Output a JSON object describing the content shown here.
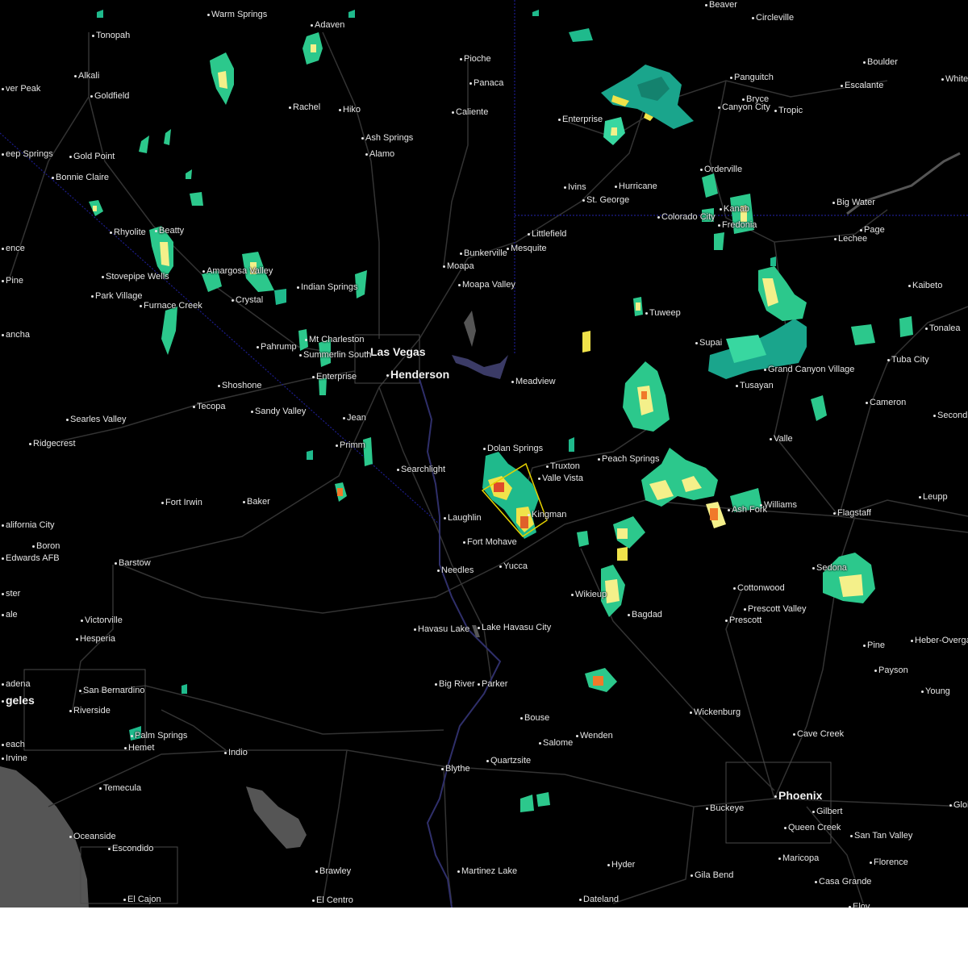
{
  "map": {
    "background_color": "#000000",
    "ocean_color": "#555555",
    "road_color": "#3a3a3a",
    "state_border_color": "#1c1c8c",
    "river_color": "#3b3b66",
    "warning_polygon_color": "#e6d200"
  },
  "cities": [
    {
      "name": "Warm Springs"
    },
    {
      "name": "Beaver"
    },
    {
      "name": "Circleville"
    },
    {
      "name": "Tonopah"
    },
    {
      "name": "Adaven"
    },
    {
      "name": "Pioche"
    },
    {
      "name": "Boulder"
    },
    {
      "name": "White C"
    },
    {
      "name": "ver Peak"
    },
    {
      "name": "Alkali"
    },
    {
      "name": "Panaca"
    },
    {
      "name": "Panguitch"
    },
    {
      "name": "Escalante"
    },
    {
      "name": "Goldfield"
    },
    {
      "name": "Rachel"
    },
    {
      "name": "Hiko"
    },
    {
      "name": "Caliente"
    },
    {
      "name": "Bryce"
    },
    {
      "name": "Canyon City"
    },
    {
      "name": "Tropic"
    },
    {
      "name": "Enterprise"
    },
    {
      "name": "Ash Springs"
    },
    {
      "name": "eep Springs"
    },
    {
      "name": "Alamo"
    },
    {
      "name": "Gold Point"
    },
    {
      "name": "Orderville"
    },
    {
      "name": "Bonnie Claire"
    },
    {
      "name": "Ivins"
    },
    {
      "name": "Hurricane"
    },
    {
      "name": "St. George"
    },
    {
      "name": "Big Water"
    },
    {
      "name": "Kanab"
    },
    {
      "name": "Colorado City"
    },
    {
      "name": "Fredonia"
    },
    {
      "name": "Page"
    },
    {
      "name": "Rhyolite"
    },
    {
      "name": "Beatty"
    },
    {
      "name": "Littlefield"
    },
    {
      "name": "Lechee"
    },
    {
      "name": "Bunkerville"
    },
    {
      "name": "Mesquite"
    },
    {
      "name": "ence"
    },
    {
      "name": "Amargosa Valley"
    },
    {
      "name": "Moapa"
    },
    {
      "name": "Pine"
    },
    {
      "name": "Stovepipe Wells"
    },
    {
      "name": "Indian Springs"
    },
    {
      "name": "Moapa Valley"
    },
    {
      "name": "Kaibeto"
    },
    {
      "name": "Park Village"
    },
    {
      "name": "Crystal"
    },
    {
      "name": "Furnace Creek"
    },
    {
      "name": "Tuweep"
    },
    {
      "name": "Tonalea"
    },
    {
      "name": "ancha"
    },
    {
      "name": "Mt Charleston"
    },
    {
      "name": "Supai"
    },
    {
      "name": "Tusayan"
    },
    {
      "name": "Grand Canyon Village"
    },
    {
      "name": "Tuba City"
    },
    {
      "name": "Pahrump"
    },
    {
      "name": "Las Vegas",
      "major": true
    },
    {
      "name": "Summerlin South"
    },
    {
      "name": "Henderson",
      "major": true
    },
    {
      "name": "Enterprise"
    },
    {
      "name": "Meadview"
    },
    {
      "name": "Shoshone"
    },
    {
      "name": "Tecopa"
    },
    {
      "name": "Sandy Valley"
    },
    {
      "name": "Cameron"
    },
    {
      "name": "Second M"
    },
    {
      "name": "Searles Valley"
    },
    {
      "name": "Jean"
    },
    {
      "name": "Valle"
    },
    {
      "name": "Ridgecrest"
    },
    {
      "name": "Dolan Springs"
    },
    {
      "name": "Primm"
    },
    {
      "name": "Truxton"
    },
    {
      "name": "Peach Springs"
    },
    {
      "name": "Searchlight"
    },
    {
      "name": "Valle Vista"
    },
    {
      "name": "Leupp"
    },
    {
      "name": "Fort Irwin"
    },
    {
      "name": "Baker"
    },
    {
      "name": "Williams"
    },
    {
      "name": "Ash Fork"
    },
    {
      "name": "Flagstaff"
    },
    {
      "name": "Laughlin"
    },
    {
      "name": "Kingman"
    },
    {
      "name": "alifornia City"
    },
    {
      "name": "Fort Mohave"
    },
    {
      "name": "Boron"
    },
    {
      "name": "Sedona"
    },
    {
      "name": "Edwards AFB"
    },
    {
      "name": "Barstow"
    },
    {
      "name": "Needles"
    },
    {
      "name": "Yucca"
    },
    {
      "name": "Cottonwood"
    },
    {
      "name": "Wikieup"
    },
    {
      "name": "ster"
    },
    {
      "name": "Prescott Valley"
    },
    {
      "name": "ale"
    },
    {
      "name": "Bagdad"
    },
    {
      "name": "Prescott"
    },
    {
      "name": "Victorville"
    },
    {
      "name": "Lake Havasu City"
    },
    {
      "name": "Havasu Lake"
    },
    {
      "name": "Hesperia"
    },
    {
      "name": "Pine"
    },
    {
      "name": "Heber-Overgaa"
    },
    {
      "name": "Payson"
    },
    {
      "name": "Big River"
    },
    {
      "name": "Parker"
    },
    {
      "name": "adena"
    },
    {
      "name": "San Bernardino"
    },
    {
      "name": "Young"
    },
    {
      "name": "geles",
      "major": true
    },
    {
      "name": "Riverside"
    },
    {
      "name": "Wickenburg"
    },
    {
      "name": "Bouse"
    },
    {
      "name": "Palm Springs"
    },
    {
      "name": "Wenden"
    },
    {
      "name": "Salome"
    },
    {
      "name": "Cave Creek"
    },
    {
      "name": "each"
    },
    {
      "name": "Hemet"
    },
    {
      "name": "Indio"
    },
    {
      "name": "Irvine"
    },
    {
      "name": "Quartzsite"
    },
    {
      "name": "Blythe"
    },
    {
      "name": "Temecula"
    },
    {
      "name": "Phoenix",
      "major": true
    },
    {
      "name": "Buckeye"
    },
    {
      "name": "Gilbert"
    },
    {
      "name": "Glob"
    },
    {
      "name": "Queen Creek"
    },
    {
      "name": "San Tan Valley"
    },
    {
      "name": "Oceanside"
    },
    {
      "name": "Escondido"
    },
    {
      "name": "Maricopa"
    },
    {
      "name": "Florence"
    },
    {
      "name": "Martinez Lake"
    },
    {
      "name": "Hyder"
    },
    {
      "name": "Brawley"
    },
    {
      "name": "Gila Bend"
    },
    {
      "name": "Casa Grande"
    },
    {
      "name": "El Cajon"
    },
    {
      "name": "El Centro"
    },
    {
      "name": "Dateland"
    },
    {
      "name": "Eloy"
    }
  ]
}
